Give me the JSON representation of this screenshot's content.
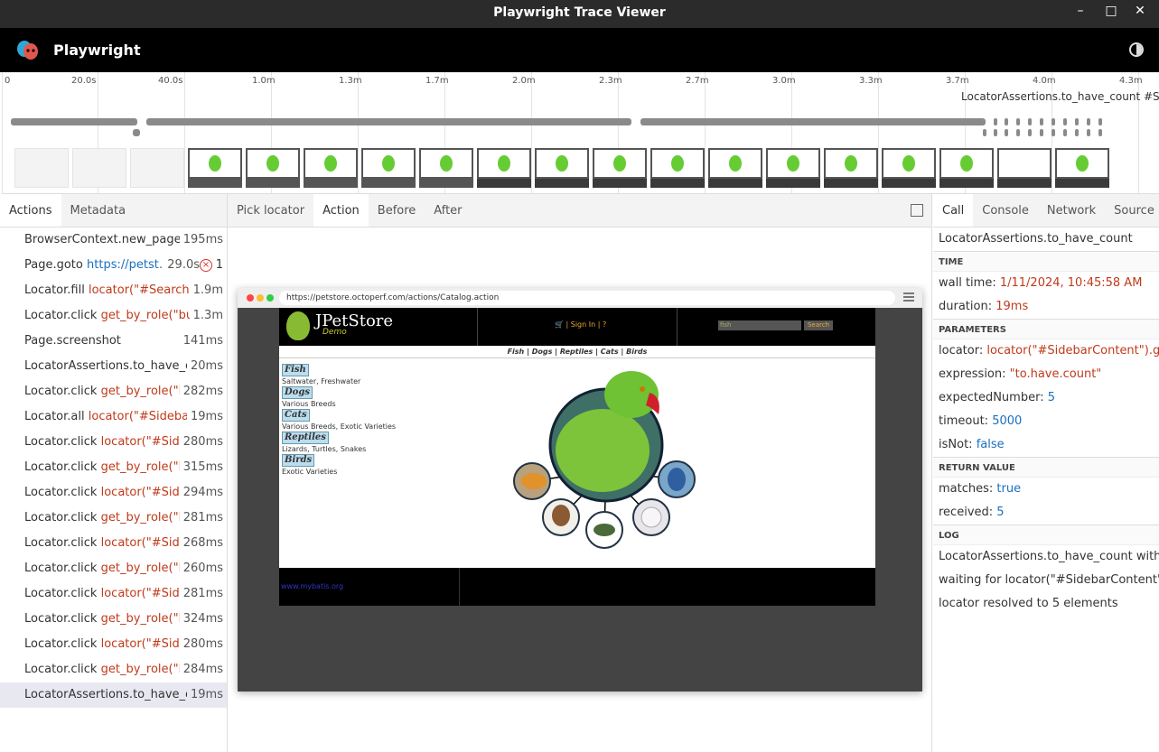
{
  "window": {
    "title": "Playwright Trace Viewer",
    "controls": [
      "minimize",
      "maximize",
      "close"
    ]
  },
  "header": {
    "app_name": "Playwright",
    "logo_icon": "playwright-masks-icon",
    "theme_toggle_icon": "theme-toggle-icon"
  },
  "timeline": {
    "ticks": [
      "0",
      "20.0s",
      "40.0s",
      "1.0m",
      "1.3m",
      "1.7m",
      "2.0m",
      "2.3m",
      "2.7m",
      "3.0m",
      "3.3m",
      "3.7m",
      "4.0m",
      "4.3m"
    ],
    "hover_label": "LocatorAssertions.to_have_count #Si"
  },
  "left_panel": {
    "tabs": [
      "Actions",
      "Metadata"
    ],
    "active_tab": "Actions",
    "actions": [
      {
        "name": "BrowserContext.new_page",
        "arg": "",
        "arg_type": "",
        "duration": "195ms"
      },
      {
        "name": "Page.goto",
        "arg": "https://petst…",
        "arg_type": "url",
        "duration": "29.0s",
        "error_count": "1"
      },
      {
        "name": "Locator.fill",
        "arg": "locator(\"#Search…",
        "arg_type": "loc",
        "duration": "1.9m"
      },
      {
        "name": "Locator.click",
        "arg": "get_by_role(\"bu…",
        "arg_type": "loc",
        "duration": "1.3m"
      },
      {
        "name": "Page.screenshot",
        "arg": "",
        "arg_type": "",
        "duration": "141ms"
      },
      {
        "name": "LocatorAssertions.to_have_c…",
        "arg": "",
        "arg_type": "",
        "duration": "20ms"
      },
      {
        "name": "Locator.click",
        "arg": "get_by_role(\"l…",
        "arg_type": "loc",
        "duration": "282ms"
      },
      {
        "name": "Locator.all",
        "arg": "locator(\"#Sidebar…",
        "arg_type": "loc",
        "duration": "19ms"
      },
      {
        "name": "Locator.click",
        "arg": "locator(\"#Side…",
        "arg_type": "loc",
        "duration": "280ms"
      },
      {
        "name": "Locator.click",
        "arg": "get_by_role(\"l…",
        "arg_type": "loc",
        "duration": "315ms"
      },
      {
        "name": "Locator.click",
        "arg": "locator(\"#Side…",
        "arg_type": "loc",
        "duration": "294ms"
      },
      {
        "name": "Locator.click",
        "arg": "get_by_role(\"l…",
        "arg_type": "loc",
        "duration": "281ms"
      },
      {
        "name": "Locator.click",
        "arg": "locator(\"#Side…",
        "arg_type": "loc",
        "duration": "268ms"
      },
      {
        "name": "Locator.click",
        "arg": "get_by_role(\"l…",
        "arg_type": "loc",
        "duration": "260ms"
      },
      {
        "name": "Locator.click",
        "arg": "locator(\"#Side…",
        "arg_type": "loc",
        "duration": "281ms"
      },
      {
        "name": "Locator.click",
        "arg": "get_by_role(\"l…",
        "arg_type": "loc",
        "duration": "324ms"
      },
      {
        "name": "Locator.click",
        "arg": "locator(\"#Side…",
        "arg_type": "loc",
        "duration": "280ms"
      },
      {
        "name": "Locator.click",
        "arg": "get_by_role(\"l…",
        "arg_type": "loc",
        "duration": "284ms"
      },
      {
        "name": "LocatorAssertions.to_have_c…",
        "arg": "",
        "arg_type": "",
        "duration": "19ms",
        "selected": true
      }
    ]
  },
  "center_panel": {
    "tabs": [
      "Pick locator",
      "Action",
      "Before",
      "After"
    ],
    "active_tab": "Action",
    "popout_icon": "open-in-new-window-icon",
    "snapshot": {
      "url": "https://petstore.octoperf.com/actions/Catalog.action",
      "site": {
        "logo": "JPetStore",
        "logo_sub": "Demo",
        "sign_in": "Sign In",
        "help": "?",
        "search_value": "fish",
        "search_button": "Search",
        "top_menu": [
          "Fish",
          "Dogs",
          "Reptiles",
          "Cats",
          "Birds"
        ],
        "categories": [
          {
            "name": "Fish",
            "desc": "Saltwater, Freshwater"
          },
          {
            "name": "Dogs",
            "desc": "Various Breeds"
          },
          {
            "name": "Cats",
            "desc": "Various Breeds, Exotic Varieties"
          },
          {
            "name": "Reptiles",
            "desc": "Lizards, Turtles, Snakes"
          },
          {
            "name": "Birds",
            "desc": "Exotic Varieties"
          }
        ],
        "footer_link": "www.mybatis.org"
      }
    }
  },
  "right_panel": {
    "tabs": [
      "Call",
      "Console",
      "Network",
      "Source"
    ],
    "active_tab": "Call",
    "call_title": "LocatorAssertions.to_have_count",
    "time": {
      "label": "TIME",
      "wall_time_key": "wall time:",
      "wall_time": "1/11/2024, 10:45:58 AM",
      "duration_key": "duration:",
      "duration": "19ms"
    },
    "parameters": {
      "label": "PARAMETERS",
      "items": [
        {
          "key": "locator:",
          "value": "locator(\"#SidebarContent\").g…",
          "color": "red"
        },
        {
          "key": "expression:",
          "value": "\"to.have.count\"",
          "color": "red"
        },
        {
          "key": "expectedNumber:",
          "value": "5",
          "color": "blue"
        },
        {
          "key": "timeout:",
          "value": "5000",
          "color": "blue"
        },
        {
          "key": "isNot:",
          "value": "false",
          "color": "blue"
        }
      ]
    },
    "return_value": {
      "label": "RETURN VALUE",
      "items": [
        {
          "key": "matches:",
          "value": "true",
          "color": "blue"
        },
        {
          "key": "received:",
          "value": "5",
          "color": "blue"
        }
      ]
    },
    "log": {
      "label": "LOG",
      "lines": [
        "LocatorAssertions.to_have_count with tim",
        "waiting for locator(\"#SidebarContent\").ge",
        "locator resolved to 5 elements"
      ]
    }
  },
  "colors": {
    "accent_red": "#c03a1a",
    "accent_blue": "#1a6fc0",
    "header_bg": "#000000",
    "titlebar_bg": "#2b2b2b"
  }
}
